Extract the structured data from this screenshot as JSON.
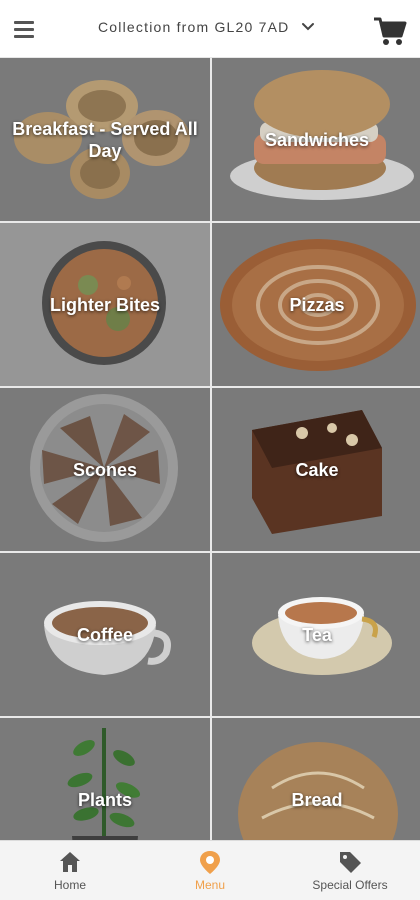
{
  "header": {
    "location_label": "Collection from GL20 7AD",
    "menu_icon": "hamburger-icon",
    "cart_icon": "cart-icon",
    "dropdown_icon": "chevron-down-icon"
  },
  "categories": [
    {
      "label": "Breakfast - Served All Day",
      "image": "crumpets"
    },
    {
      "label": "Sandwiches",
      "image": "sandwich"
    },
    {
      "label": "Lighter Bites",
      "image": "soup-bowl"
    },
    {
      "label": "Pizzas",
      "image": "pizza"
    },
    {
      "label": "Scones",
      "image": "scones-plate"
    },
    {
      "label": "Cake",
      "image": "chocolate-cake"
    },
    {
      "label": "Coffee",
      "image": "coffee-cup"
    },
    {
      "label": "Tea",
      "image": "tea-cup"
    },
    {
      "label": "Plants",
      "image": "potted-plant"
    },
    {
      "label": "Bread",
      "image": "bread-loaf"
    }
  ],
  "bottom_nav": {
    "items": [
      {
        "label": "Home",
        "icon": "home-icon",
        "active": false
      },
      {
        "label": "Menu",
        "icon": "menu-pin-icon",
        "active": true
      },
      {
        "label": "Special Offers",
        "icon": "tag-icon",
        "active": false
      }
    ],
    "active_color": "#f0a04b",
    "inactive_color": "#555555"
  }
}
